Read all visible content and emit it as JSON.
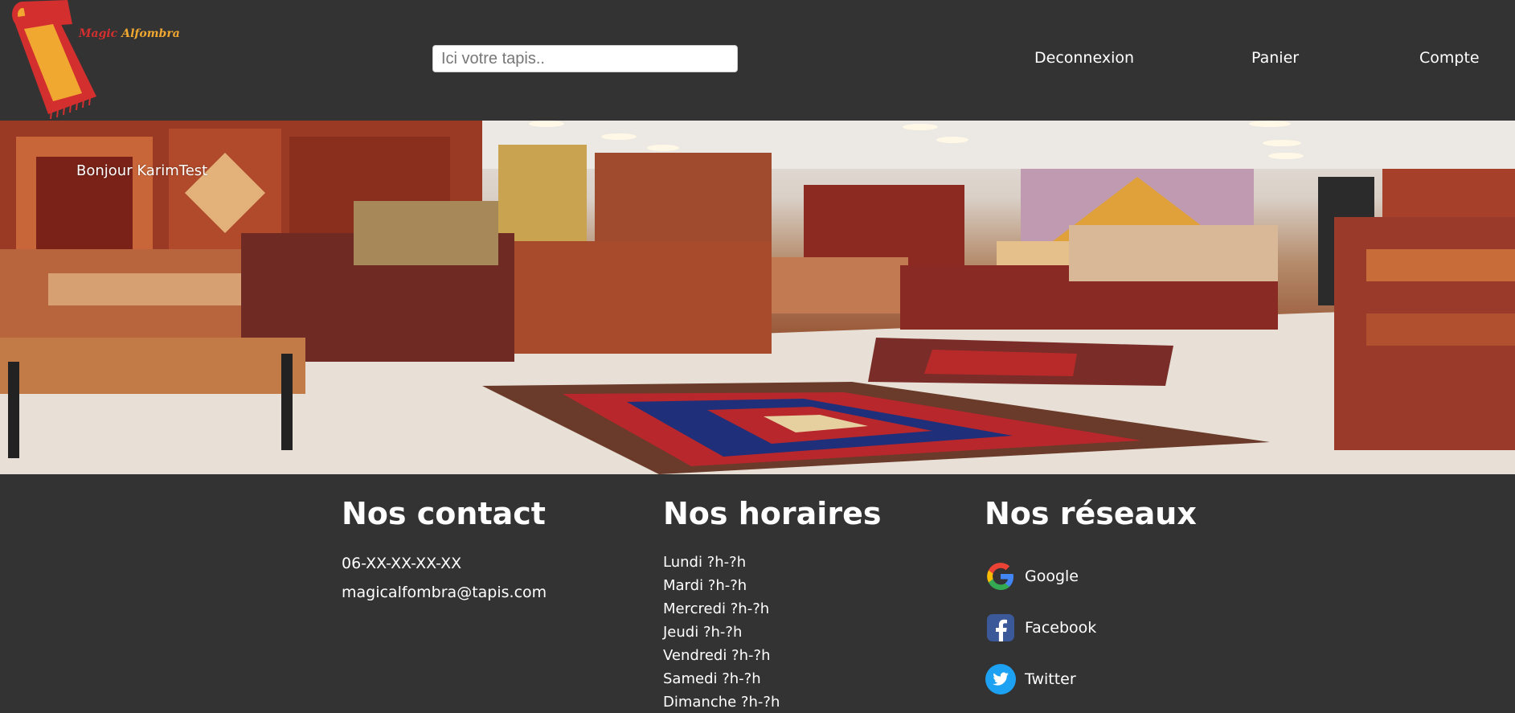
{
  "header": {
    "logo": {
      "word1": "Magic",
      "word2": "Alfombra"
    },
    "search": {
      "placeholder": "Ici votre tapis..",
      "value": ""
    },
    "nav": {
      "logout": "Deconnexion",
      "cart": "Panier",
      "account": "Compte"
    }
  },
  "hero": {
    "greeting": "Bonjour KarimTest"
  },
  "footer": {
    "contact": {
      "title": "Nos contact",
      "phone": "06-XX-XX-XX-XX",
      "email": "magicalfombra@tapis.com"
    },
    "hours": {
      "title": "Nos horaires",
      "days": [
        "Lundi ?h-?h",
        "Mardi ?h-?h",
        "Mercredi ?h-?h",
        "Jeudi ?h-?h",
        "Vendredi ?h-?h",
        "Samedi ?h-?h",
        "Dimanche ?h-?h"
      ]
    },
    "social": {
      "title": "Nos réseaux",
      "items": [
        {
          "label": "Google",
          "icon": "google-icon"
        },
        {
          "label": "Facebook",
          "icon": "facebook-icon"
        },
        {
          "label": "Twitter",
          "icon": "twitter-icon"
        }
      ]
    }
  },
  "colors": {
    "background": "#333333",
    "text": "#ffffff",
    "logo_red": "#d32f2f",
    "logo_orange": "#f0a830",
    "facebook": "#3b5998",
    "twitter": "#1da1f2"
  }
}
